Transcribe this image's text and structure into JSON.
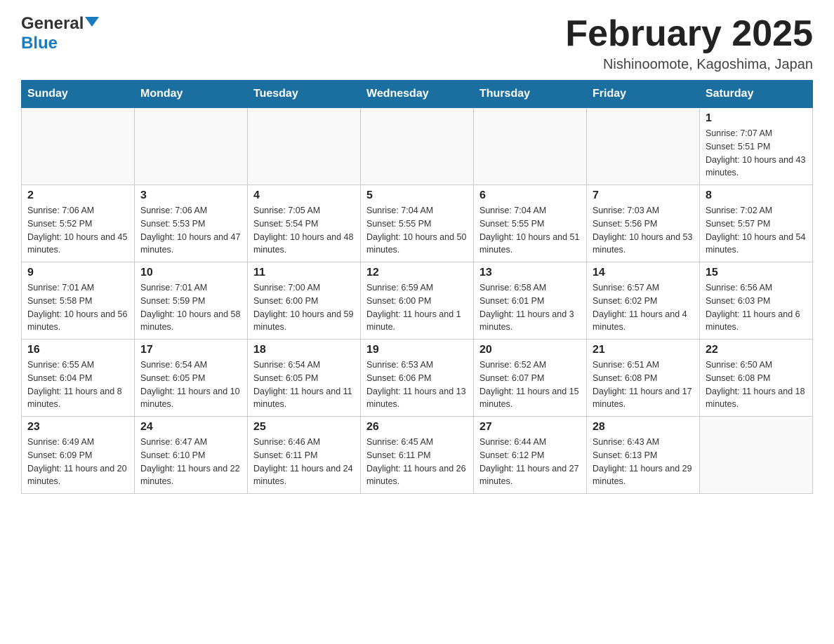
{
  "header": {
    "logo_general": "General",
    "logo_blue": "Blue",
    "month_title": "February 2025",
    "location": "Nishinoomote, Kagoshima, Japan"
  },
  "weekdays": [
    "Sunday",
    "Monday",
    "Tuesday",
    "Wednesday",
    "Thursday",
    "Friday",
    "Saturday"
  ],
  "weeks": [
    [
      {
        "day": "",
        "sunrise": "",
        "sunset": "",
        "daylight": ""
      },
      {
        "day": "",
        "sunrise": "",
        "sunset": "",
        "daylight": ""
      },
      {
        "day": "",
        "sunrise": "",
        "sunset": "",
        "daylight": ""
      },
      {
        "day": "",
        "sunrise": "",
        "sunset": "",
        "daylight": ""
      },
      {
        "day": "",
        "sunrise": "",
        "sunset": "",
        "daylight": ""
      },
      {
        "day": "",
        "sunrise": "",
        "sunset": "",
        "daylight": ""
      },
      {
        "day": "1",
        "sunrise": "Sunrise: 7:07 AM",
        "sunset": "Sunset: 5:51 PM",
        "daylight": "Daylight: 10 hours and 43 minutes."
      }
    ],
    [
      {
        "day": "2",
        "sunrise": "Sunrise: 7:06 AM",
        "sunset": "Sunset: 5:52 PM",
        "daylight": "Daylight: 10 hours and 45 minutes."
      },
      {
        "day": "3",
        "sunrise": "Sunrise: 7:06 AM",
        "sunset": "Sunset: 5:53 PM",
        "daylight": "Daylight: 10 hours and 47 minutes."
      },
      {
        "day": "4",
        "sunrise": "Sunrise: 7:05 AM",
        "sunset": "Sunset: 5:54 PM",
        "daylight": "Daylight: 10 hours and 48 minutes."
      },
      {
        "day": "5",
        "sunrise": "Sunrise: 7:04 AM",
        "sunset": "Sunset: 5:55 PM",
        "daylight": "Daylight: 10 hours and 50 minutes."
      },
      {
        "day": "6",
        "sunrise": "Sunrise: 7:04 AM",
        "sunset": "Sunset: 5:55 PM",
        "daylight": "Daylight: 10 hours and 51 minutes."
      },
      {
        "day": "7",
        "sunrise": "Sunrise: 7:03 AM",
        "sunset": "Sunset: 5:56 PM",
        "daylight": "Daylight: 10 hours and 53 minutes."
      },
      {
        "day": "8",
        "sunrise": "Sunrise: 7:02 AM",
        "sunset": "Sunset: 5:57 PM",
        "daylight": "Daylight: 10 hours and 54 minutes."
      }
    ],
    [
      {
        "day": "9",
        "sunrise": "Sunrise: 7:01 AM",
        "sunset": "Sunset: 5:58 PM",
        "daylight": "Daylight: 10 hours and 56 minutes."
      },
      {
        "day": "10",
        "sunrise": "Sunrise: 7:01 AM",
        "sunset": "Sunset: 5:59 PM",
        "daylight": "Daylight: 10 hours and 58 minutes."
      },
      {
        "day": "11",
        "sunrise": "Sunrise: 7:00 AM",
        "sunset": "Sunset: 6:00 PM",
        "daylight": "Daylight: 10 hours and 59 minutes."
      },
      {
        "day": "12",
        "sunrise": "Sunrise: 6:59 AM",
        "sunset": "Sunset: 6:00 PM",
        "daylight": "Daylight: 11 hours and 1 minute."
      },
      {
        "day": "13",
        "sunrise": "Sunrise: 6:58 AM",
        "sunset": "Sunset: 6:01 PM",
        "daylight": "Daylight: 11 hours and 3 minutes."
      },
      {
        "day": "14",
        "sunrise": "Sunrise: 6:57 AM",
        "sunset": "Sunset: 6:02 PM",
        "daylight": "Daylight: 11 hours and 4 minutes."
      },
      {
        "day": "15",
        "sunrise": "Sunrise: 6:56 AM",
        "sunset": "Sunset: 6:03 PM",
        "daylight": "Daylight: 11 hours and 6 minutes."
      }
    ],
    [
      {
        "day": "16",
        "sunrise": "Sunrise: 6:55 AM",
        "sunset": "Sunset: 6:04 PM",
        "daylight": "Daylight: 11 hours and 8 minutes."
      },
      {
        "day": "17",
        "sunrise": "Sunrise: 6:54 AM",
        "sunset": "Sunset: 6:05 PM",
        "daylight": "Daylight: 11 hours and 10 minutes."
      },
      {
        "day": "18",
        "sunrise": "Sunrise: 6:54 AM",
        "sunset": "Sunset: 6:05 PM",
        "daylight": "Daylight: 11 hours and 11 minutes."
      },
      {
        "day": "19",
        "sunrise": "Sunrise: 6:53 AM",
        "sunset": "Sunset: 6:06 PM",
        "daylight": "Daylight: 11 hours and 13 minutes."
      },
      {
        "day": "20",
        "sunrise": "Sunrise: 6:52 AM",
        "sunset": "Sunset: 6:07 PM",
        "daylight": "Daylight: 11 hours and 15 minutes."
      },
      {
        "day": "21",
        "sunrise": "Sunrise: 6:51 AM",
        "sunset": "Sunset: 6:08 PM",
        "daylight": "Daylight: 11 hours and 17 minutes."
      },
      {
        "day": "22",
        "sunrise": "Sunrise: 6:50 AM",
        "sunset": "Sunset: 6:08 PM",
        "daylight": "Daylight: 11 hours and 18 minutes."
      }
    ],
    [
      {
        "day": "23",
        "sunrise": "Sunrise: 6:49 AM",
        "sunset": "Sunset: 6:09 PM",
        "daylight": "Daylight: 11 hours and 20 minutes."
      },
      {
        "day": "24",
        "sunrise": "Sunrise: 6:47 AM",
        "sunset": "Sunset: 6:10 PM",
        "daylight": "Daylight: 11 hours and 22 minutes."
      },
      {
        "day": "25",
        "sunrise": "Sunrise: 6:46 AM",
        "sunset": "Sunset: 6:11 PM",
        "daylight": "Daylight: 11 hours and 24 minutes."
      },
      {
        "day": "26",
        "sunrise": "Sunrise: 6:45 AM",
        "sunset": "Sunset: 6:11 PM",
        "daylight": "Daylight: 11 hours and 26 minutes."
      },
      {
        "day": "27",
        "sunrise": "Sunrise: 6:44 AM",
        "sunset": "Sunset: 6:12 PM",
        "daylight": "Daylight: 11 hours and 27 minutes."
      },
      {
        "day": "28",
        "sunrise": "Sunrise: 6:43 AM",
        "sunset": "Sunset: 6:13 PM",
        "daylight": "Daylight: 11 hours and 29 minutes."
      },
      {
        "day": "",
        "sunrise": "",
        "sunset": "",
        "daylight": ""
      }
    ]
  ]
}
